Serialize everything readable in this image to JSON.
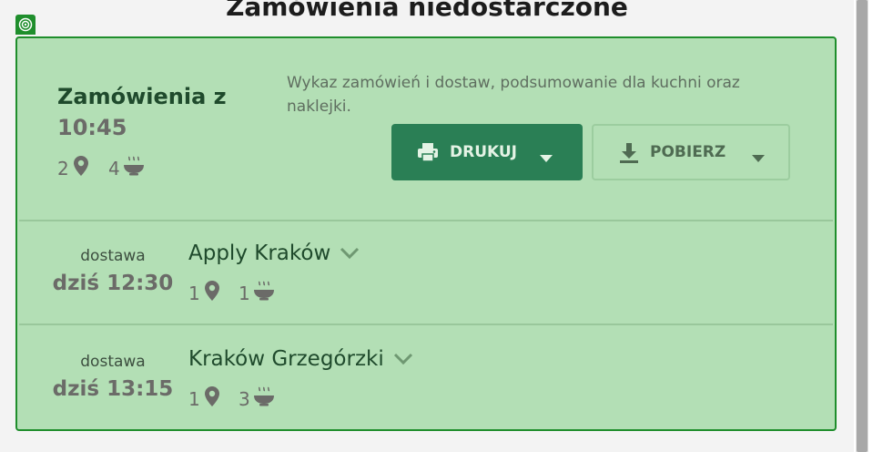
{
  "page": {
    "title": "Zamówienia niedostarczone"
  },
  "summary": {
    "title": "Zamówienia z",
    "time": "10:45",
    "locations_count": "2",
    "dishes_count": "4",
    "description": "Wykaz zamówień i dostaw, podsumowanie dla kuchni oraz naklejki."
  },
  "actions": {
    "print_label": "DRUKUJ",
    "download_label": "POBIERZ"
  },
  "deliveries": [
    {
      "type": "dostawa",
      "time": "dziś 12:30",
      "name": "Apply Kraków",
      "locations_count": "1",
      "dishes_count": "1"
    },
    {
      "type": "dostawa",
      "time": "dziś 13:15",
      "name": "Kraków Grzegórzki",
      "locations_count": "1",
      "dishes_count": "3"
    }
  ],
  "colors": {
    "card_bg": "#b3dfb5",
    "card_border": "#1f8e2c",
    "primary_button": "#2a7f55",
    "muted_text": "#6b6b68",
    "heading_text": "#1f4a2c"
  },
  "icons": [
    "target-icon",
    "location-pin-icon",
    "dish-bowl-icon",
    "printer-icon",
    "download-icon",
    "caret-down-icon",
    "chevron-down-icon"
  ]
}
